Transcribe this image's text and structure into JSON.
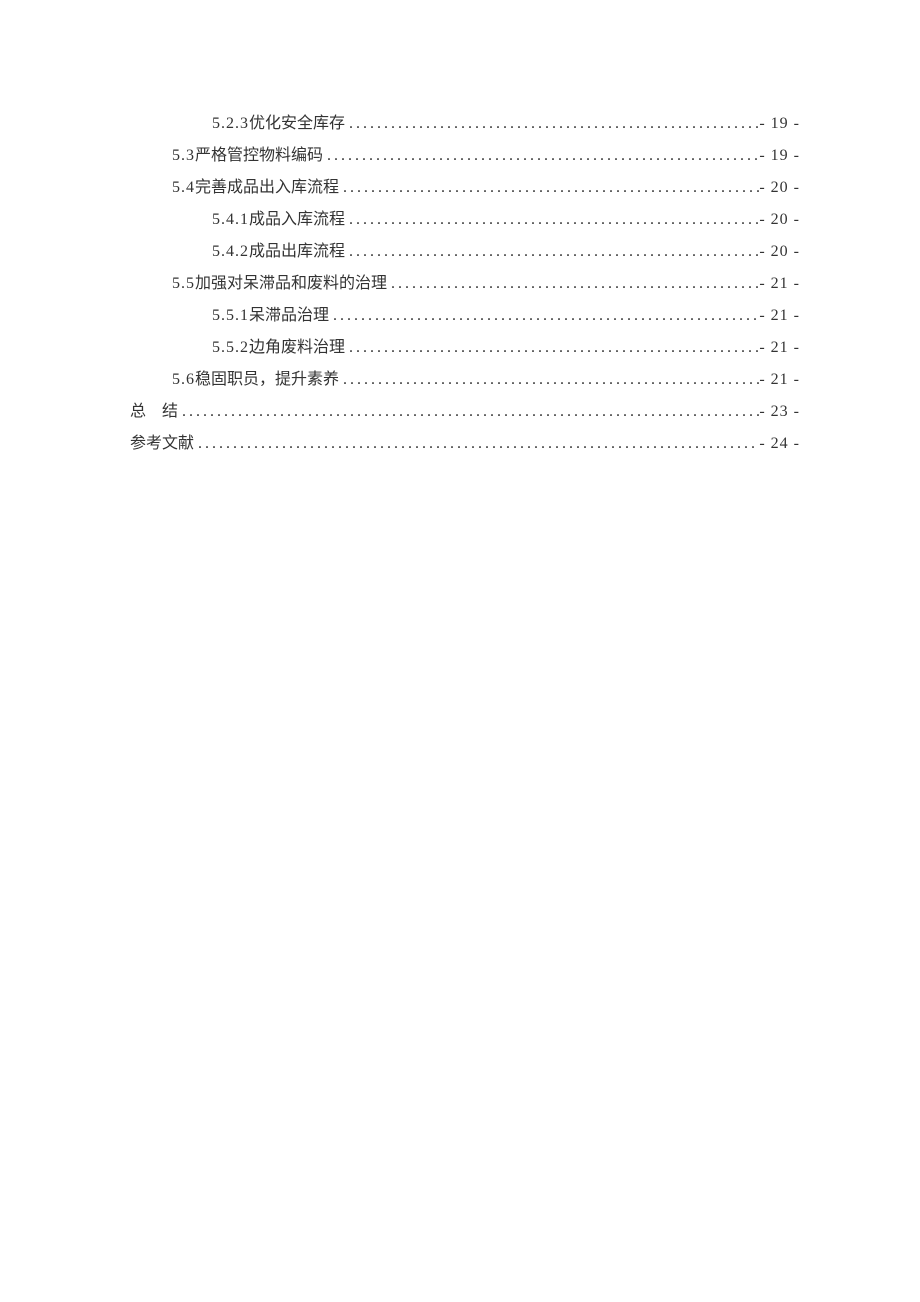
{
  "toc": {
    "entries": [
      {
        "level": 2,
        "number": "5.2.3",
        "title": "优化安全库存",
        "page": "- 19 -"
      },
      {
        "level": 1,
        "number": "5.3",
        "title": "严格管控物料编码",
        "page": "- 19 -"
      },
      {
        "level": 1,
        "number": "5.4",
        "title": "完善成品出入库流程",
        "page": "- 20 -"
      },
      {
        "level": 2,
        "number": "5.4.1",
        "title": "成品入库流程",
        "page": "- 20 -"
      },
      {
        "level": 2,
        "number": "5.4.2",
        "title": "成品出库流程",
        "page": "- 20 -"
      },
      {
        "level": 1,
        "number": "5.5",
        "title": "加强对呆滞品和废料的治理",
        "page": "- 21 -"
      },
      {
        "level": 2,
        "number": "5.5.1",
        "title": "呆滞品治理",
        "page": "- 21 -"
      },
      {
        "level": 2,
        "number": "5.5.2",
        "title": "边角废料治理",
        "page": "- 21 -"
      },
      {
        "level": 1,
        "number": "5.6 ",
        "title": "稳固职员，提升素养",
        "page": "- 21 -"
      },
      {
        "level": 0,
        "number": "",
        "title": "总　结",
        "spaced": false,
        "page": "- 23 -"
      },
      {
        "level": 0,
        "number": "",
        "title": "参考文献",
        "page": "- 24 -"
      }
    ]
  }
}
